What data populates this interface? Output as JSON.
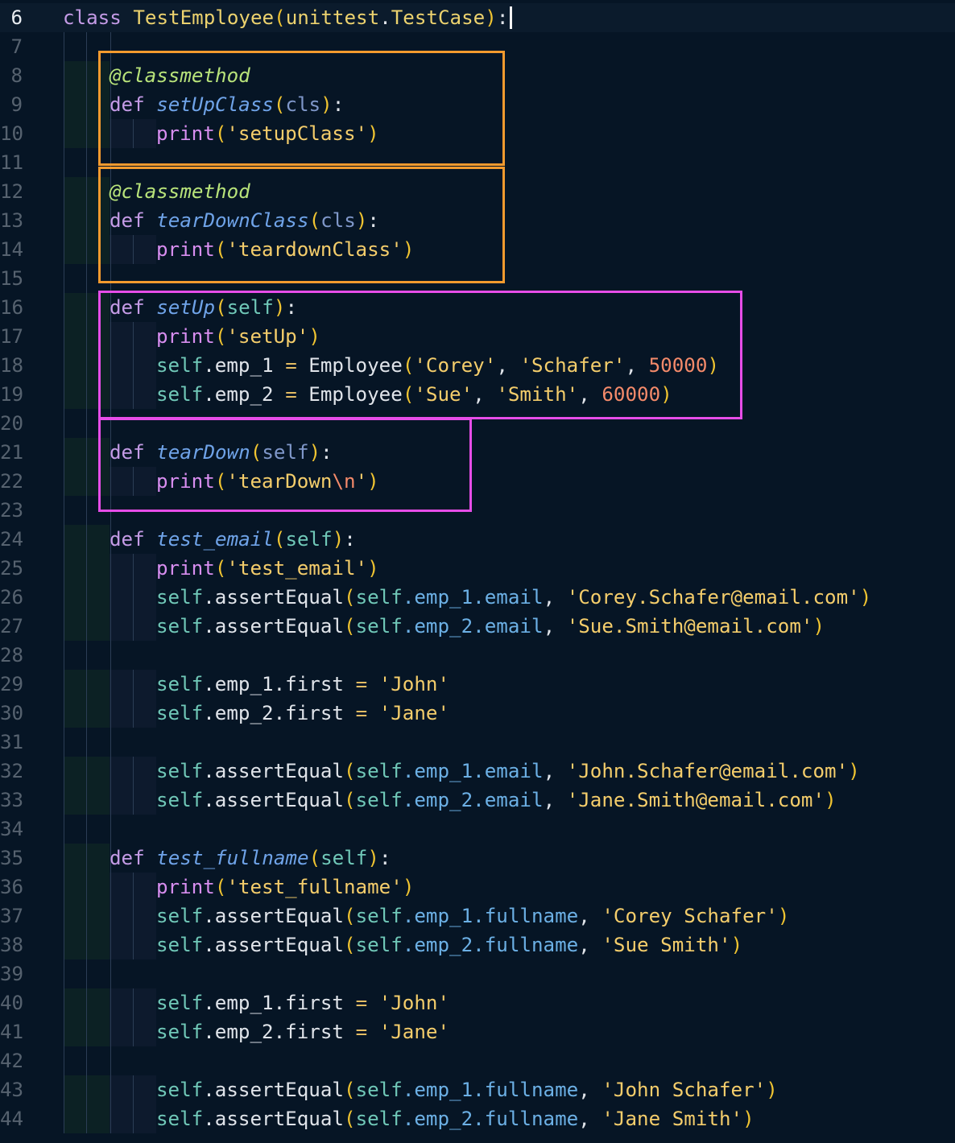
{
  "editor": {
    "language": "python",
    "colors": {
      "background": "#061525",
      "keyword": "#c49be6",
      "class_name": "#ecd26e",
      "function_name": "#6fa3e8",
      "decorator": "#b8e37a",
      "self": "#70c8b8",
      "string": "#f4cd6b",
      "number": "#f48a6a",
      "highlight_orange": "#f39a2e",
      "highlight_magenta": "#e64de8"
    },
    "current_line": 6,
    "lines": [
      {
        "n": "6",
        "indent": 0,
        "tokens": [
          [
            "kw",
            "class"
          ],
          [
            "pl",
            " "
          ],
          [
            "cls",
            "TestEmployee"
          ],
          [
            "br1",
            "("
          ],
          [
            "cls",
            "unittest"
          ],
          [
            "pl",
            "."
          ],
          [
            "cls",
            "TestCase"
          ],
          [
            "br1",
            ")"
          ],
          [
            "pl",
            ":"
          ]
        ]
      },
      {
        "n": "7",
        "indent": 0,
        "tokens": []
      },
      {
        "n": "8",
        "indent": 1,
        "tokens": [
          [
            "deco",
            "@classmethod"
          ]
        ]
      },
      {
        "n": "9",
        "indent": 1,
        "tokens": [
          [
            "kw",
            "def"
          ],
          [
            "pl",
            " "
          ],
          [
            "fn",
            "setUpClass"
          ],
          [
            "br1",
            "("
          ],
          [
            "param",
            "cls"
          ],
          [
            "br1",
            ")"
          ],
          [
            "pl",
            ":"
          ]
        ]
      },
      {
        "n": "10",
        "indent": 2,
        "tokens": [
          [
            "bi",
            "print"
          ],
          [
            "br1",
            "("
          ],
          [
            "str",
            "'setupClass'"
          ],
          [
            "br1",
            ")"
          ]
        ]
      },
      {
        "n": "11",
        "indent": 0,
        "tokens": []
      },
      {
        "n": "12",
        "indent": 1,
        "tokens": [
          [
            "deco",
            "@classmethod"
          ]
        ]
      },
      {
        "n": "13",
        "indent": 1,
        "tokens": [
          [
            "kw",
            "def"
          ],
          [
            "pl",
            " "
          ],
          [
            "fn",
            "tearDownClass"
          ],
          [
            "br1",
            "("
          ],
          [
            "param",
            "cls"
          ],
          [
            "br1",
            ")"
          ],
          [
            "pl",
            ":"
          ]
        ]
      },
      {
        "n": "14",
        "indent": 2,
        "tokens": [
          [
            "bi",
            "print"
          ],
          [
            "br1",
            "("
          ],
          [
            "str",
            "'teardownClass'"
          ],
          [
            "br1",
            ")"
          ]
        ]
      },
      {
        "n": "15",
        "indent": 0,
        "tokens": []
      },
      {
        "n": "16",
        "indent": 1,
        "tokens": [
          [
            "kw",
            "def"
          ],
          [
            "pl",
            " "
          ],
          [
            "fn",
            "setUp"
          ],
          [
            "br1",
            "("
          ],
          [
            "self",
            "self"
          ],
          [
            "br1",
            ")"
          ],
          [
            "pl",
            ":"
          ]
        ]
      },
      {
        "n": "17",
        "indent": 2,
        "tokens": [
          [
            "bi",
            "print"
          ],
          [
            "br1",
            "("
          ],
          [
            "str",
            "'setUp'"
          ],
          [
            "br1",
            ")"
          ]
        ]
      },
      {
        "n": "18",
        "indent": 2,
        "tokens": [
          [
            "self",
            "self"
          ],
          [
            "pl",
            ".emp_1 "
          ],
          [
            "op",
            "="
          ],
          [
            "pl",
            " Employee"
          ],
          [
            "br1",
            "("
          ],
          [
            "str",
            "'Corey'"
          ],
          [
            "pl",
            ", "
          ],
          [
            "str",
            "'Schafer'"
          ],
          [
            "pl",
            ", "
          ],
          [
            "num",
            "50000"
          ],
          [
            "br1",
            ")"
          ]
        ]
      },
      {
        "n": "19",
        "indent": 2,
        "tokens": [
          [
            "self",
            "self"
          ],
          [
            "pl",
            ".emp_2 "
          ],
          [
            "op",
            "="
          ],
          [
            "pl",
            " Employee"
          ],
          [
            "br1",
            "("
          ],
          [
            "str",
            "'Sue'"
          ],
          [
            "pl",
            ", "
          ],
          [
            "str",
            "'Smith'"
          ],
          [
            "pl",
            ", "
          ],
          [
            "num",
            "60000"
          ],
          [
            "br1",
            ")"
          ]
        ]
      },
      {
        "n": "20",
        "indent": 0,
        "tokens": []
      },
      {
        "n": "21",
        "indent": 1,
        "tokens": [
          [
            "kw",
            "def"
          ],
          [
            "pl",
            " "
          ],
          [
            "fn",
            "tearDown"
          ],
          [
            "br1",
            "("
          ],
          [
            "param",
            "self"
          ],
          [
            "br1",
            ")"
          ],
          [
            "pl",
            ":"
          ]
        ]
      },
      {
        "n": "22",
        "indent": 2,
        "tokens": [
          [
            "bi",
            "print"
          ],
          [
            "br1",
            "("
          ],
          [
            "str",
            "'tearDown"
          ],
          [
            "esc",
            "\\n"
          ],
          [
            "str",
            "'"
          ],
          [
            "br1",
            ")"
          ]
        ]
      },
      {
        "n": "23",
        "indent": 0,
        "tokens": []
      },
      {
        "n": "24",
        "indent": 1,
        "tokens": [
          [
            "kw",
            "def"
          ],
          [
            "pl",
            " "
          ],
          [
            "fn",
            "test_email"
          ],
          [
            "br1",
            "("
          ],
          [
            "self",
            "self"
          ],
          [
            "br1",
            ")"
          ],
          [
            "pl",
            ":"
          ]
        ]
      },
      {
        "n": "25",
        "indent": 2,
        "tokens": [
          [
            "bi",
            "print"
          ],
          [
            "br1",
            "("
          ],
          [
            "str",
            "'test_email'"
          ],
          [
            "br1",
            ")"
          ]
        ]
      },
      {
        "n": "26",
        "indent": 2,
        "tokens": [
          [
            "self",
            "self"
          ],
          [
            "pl",
            ".assertEqual"
          ],
          [
            "br1",
            "("
          ],
          [
            "self",
            "self"
          ],
          [
            "attr",
            ".emp_1.email"
          ],
          [
            "pl",
            ", "
          ],
          [
            "str",
            "'Corey.Schafer@email.com'"
          ],
          [
            "br1",
            ")"
          ]
        ]
      },
      {
        "n": "27",
        "indent": 2,
        "tokens": [
          [
            "self",
            "self"
          ],
          [
            "pl",
            ".assertEqual"
          ],
          [
            "br1",
            "("
          ],
          [
            "self",
            "self"
          ],
          [
            "attr",
            ".emp_2.email"
          ],
          [
            "pl",
            ", "
          ],
          [
            "str",
            "'Sue.Smith@email.com'"
          ],
          [
            "br1",
            ")"
          ]
        ]
      },
      {
        "n": "28",
        "indent": 0,
        "tokens": []
      },
      {
        "n": "29",
        "indent": 2,
        "tokens": [
          [
            "self",
            "self"
          ],
          [
            "pl",
            ".emp_1.first "
          ],
          [
            "op",
            "="
          ],
          [
            "pl",
            " "
          ],
          [
            "str",
            "'John'"
          ]
        ]
      },
      {
        "n": "30",
        "indent": 2,
        "tokens": [
          [
            "self",
            "self"
          ],
          [
            "pl",
            ".emp_2.first "
          ],
          [
            "op",
            "="
          ],
          [
            "pl",
            " "
          ],
          [
            "str",
            "'Jane'"
          ]
        ]
      },
      {
        "n": "31",
        "indent": 0,
        "tokens": []
      },
      {
        "n": "32",
        "indent": 2,
        "tokens": [
          [
            "self",
            "self"
          ],
          [
            "pl",
            ".assertEqual"
          ],
          [
            "br1",
            "("
          ],
          [
            "self",
            "self"
          ],
          [
            "attr",
            ".emp_1.email"
          ],
          [
            "pl",
            ", "
          ],
          [
            "str",
            "'John.Schafer@email.com'"
          ],
          [
            "br1",
            ")"
          ]
        ]
      },
      {
        "n": "33",
        "indent": 2,
        "tokens": [
          [
            "self",
            "self"
          ],
          [
            "pl",
            ".assertEqual"
          ],
          [
            "br1",
            "("
          ],
          [
            "self",
            "self"
          ],
          [
            "attr",
            ".emp_2.email"
          ],
          [
            "pl",
            ", "
          ],
          [
            "str",
            "'Jane.Smith@email.com'"
          ],
          [
            "br1",
            ")"
          ]
        ]
      },
      {
        "n": "34",
        "indent": 0,
        "tokens": []
      },
      {
        "n": "35",
        "indent": 1,
        "tokens": [
          [
            "kw",
            "def"
          ],
          [
            "pl",
            " "
          ],
          [
            "fn",
            "test_fullname"
          ],
          [
            "br1",
            "("
          ],
          [
            "self",
            "self"
          ],
          [
            "br1",
            ")"
          ],
          [
            "pl",
            ":"
          ]
        ]
      },
      {
        "n": "36",
        "indent": 2,
        "tokens": [
          [
            "bi",
            "print"
          ],
          [
            "br1",
            "("
          ],
          [
            "str",
            "'test_fullname'"
          ],
          [
            "br1",
            ")"
          ]
        ]
      },
      {
        "n": "37",
        "indent": 2,
        "tokens": [
          [
            "self",
            "self"
          ],
          [
            "pl",
            ".assertEqual"
          ],
          [
            "br1",
            "("
          ],
          [
            "self",
            "self"
          ],
          [
            "attr",
            ".emp_1.fullname"
          ],
          [
            "pl",
            ", "
          ],
          [
            "str",
            "'Corey Schafer'"
          ],
          [
            "br1",
            ")"
          ]
        ]
      },
      {
        "n": "38",
        "indent": 2,
        "tokens": [
          [
            "self",
            "self"
          ],
          [
            "pl",
            ".assertEqual"
          ],
          [
            "br1",
            "("
          ],
          [
            "self",
            "self"
          ],
          [
            "attr",
            ".emp_2.fullname"
          ],
          [
            "pl",
            ", "
          ],
          [
            "str",
            "'Sue Smith'"
          ],
          [
            "br1",
            ")"
          ]
        ]
      },
      {
        "n": "39",
        "indent": 0,
        "tokens": []
      },
      {
        "n": "40",
        "indent": 2,
        "tokens": [
          [
            "self",
            "self"
          ],
          [
            "pl",
            ".emp_1.first "
          ],
          [
            "op",
            "="
          ],
          [
            "pl",
            " "
          ],
          [
            "str",
            "'John'"
          ]
        ]
      },
      {
        "n": "41",
        "indent": 2,
        "tokens": [
          [
            "self",
            "self"
          ],
          [
            "pl",
            ".emp_2.first "
          ],
          [
            "op",
            "="
          ],
          [
            "pl",
            " "
          ],
          [
            "str",
            "'Jane'"
          ]
        ]
      },
      {
        "n": "42",
        "indent": 0,
        "tokens": []
      },
      {
        "n": "43",
        "indent": 2,
        "tokens": [
          [
            "self",
            "self"
          ],
          [
            "pl",
            ".assertEqual"
          ],
          [
            "br1",
            "("
          ],
          [
            "self",
            "self"
          ],
          [
            "attr",
            ".emp_1.fullname"
          ],
          [
            "pl",
            ", "
          ],
          [
            "str",
            "'John Schafer'"
          ],
          [
            "br1",
            ")"
          ]
        ]
      },
      {
        "n": "44",
        "indent": 2,
        "tokens": [
          [
            "self",
            "self"
          ],
          [
            "pl",
            ".assertEqual"
          ],
          [
            "br1",
            "("
          ],
          [
            "self",
            "self"
          ],
          [
            "attr",
            ".emp_2.fullname"
          ],
          [
            "pl",
            ", "
          ],
          [
            "str",
            "'Jane Smith'"
          ],
          [
            "br1",
            ")"
          ]
        ]
      }
    ],
    "highlights": [
      {
        "name": "classmethod-setup-box",
        "color": "orange",
        "from_line": 8,
        "to_line": 10
      },
      {
        "name": "classmethod-teardown-box",
        "color": "orange",
        "from_line": 12,
        "to_line": 14
      },
      {
        "name": "setup-method-box",
        "color": "magenta",
        "from_line": 16,
        "to_line": 19
      },
      {
        "name": "teardown-method-box",
        "color": "magenta",
        "from_line": 21,
        "to_line": 22
      }
    ]
  }
}
